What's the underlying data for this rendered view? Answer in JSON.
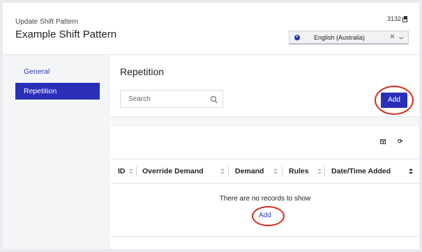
{
  "header": {
    "subtitle": "Update Shift Pattern",
    "title": "Example Shift Pattern",
    "record_id": "3132",
    "language": {
      "value": "English (Australia)",
      "clear": "✕",
      "chevron": "⌄"
    }
  },
  "sidebar": {
    "items": [
      {
        "label": "General",
        "active": false
      },
      {
        "label": "Repetition",
        "active": true
      }
    ]
  },
  "section": {
    "title": "Repetition",
    "search_placeholder": "Search",
    "add_label": "Add"
  },
  "table": {
    "columns": [
      "ID",
      "Override Demand",
      "Demand",
      "Rules",
      "Date/Time Added"
    ],
    "rows": [],
    "empty_message": "There are no records to show",
    "empty_add_label": "Add",
    "refresh_glyph": "⟳"
  },
  "colors": {
    "accent": "#2b2fb8",
    "highlight_ring": "#d62b1f"
  }
}
